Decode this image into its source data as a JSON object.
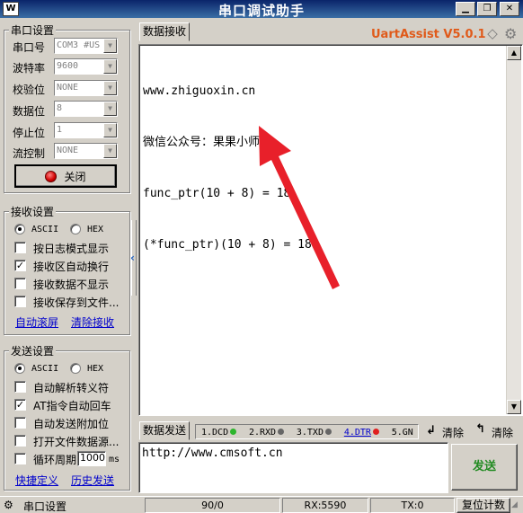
{
  "app": {
    "title": "串口调试助手",
    "logo": "W",
    "brand": "UartAssist V5.0.1"
  },
  "serial": {
    "group_title": "串口设置",
    "port_label": "串口号",
    "port_value": "COM3 #US",
    "baud_label": "波特率",
    "baud_value": "9600",
    "parity_label": "校验位",
    "parity_value": "NONE",
    "databits_label": "数据位",
    "databits_value": "8",
    "stopbits_label": "停止位",
    "stopbits_value": "1",
    "flow_label": "流控制",
    "flow_value": "NONE",
    "toggle_label": "关闭"
  },
  "recv": {
    "group_title": "接收设置",
    "ascii": "ASCII",
    "hex": "HEX",
    "opt1": "按日志模式显示",
    "opt2": "接收区自动换行",
    "opt3": "接收数据不显示",
    "opt4": "接收保存到文件...",
    "link1": "自动滚屏",
    "link2": "清除接收"
  },
  "send": {
    "group_title": "发送设置",
    "ascii": "ASCII",
    "hex": "HEX",
    "opt1": "自动解析转义符",
    "opt2": "AT指令自动回车",
    "opt3": "自动发送附加位",
    "opt4": "打开文件数据源...",
    "opt5": "循环周期",
    "period_value": "1000",
    "period_unit": "ms",
    "link1": "快捷定义",
    "link2": "历史发送"
  },
  "rx_panel": {
    "tab": "数据接收",
    "lines": [
      "www.zhiguoxin.cn",
      "微信公众号：果果小师弟",
      "func_ptr(10 + 8) = 18",
      "(*func_ptr)(10 + 8) = 18"
    ]
  },
  "tx_panel": {
    "tab": "数据发送",
    "signals": [
      "1.DCD",
      "2.RXD",
      "3.TXD",
      "4.DTR",
      "5.GN"
    ],
    "clear1": "清除",
    "clear2": "清除",
    "input_value": "http://www.cmsoft.cn",
    "send_label": "发送"
  },
  "status": {
    "label": "串口设置",
    "count": "90/0",
    "rx": "RX:5590",
    "tx": "TX:0",
    "reset": "复位计数"
  },
  "colors": {
    "brand": "#e05a1a",
    "send_text": "#228b22",
    "arrow": "#e8202a",
    "led_green": "#2db52d",
    "led_red": "#e02020",
    "led_gray": "#666666"
  }
}
